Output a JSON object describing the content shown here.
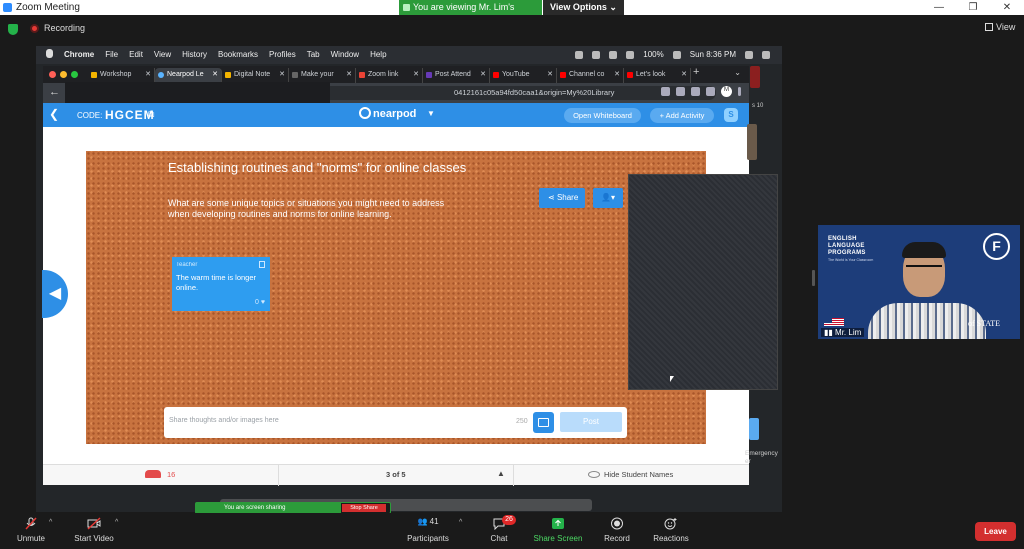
{
  "zoom": {
    "window_title": "Zoom Meeting",
    "viewing_banner": "You are viewing Mr. Lim's screen",
    "view_options": "View Options",
    "recording": "Recording",
    "view_label": "View"
  },
  "mac": {
    "menu": [
      "Chrome",
      "File",
      "Edit",
      "View",
      "History",
      "Bookmarks",
      "Profiles",
      "Tab",
      "Window",
      "Help"
    ],
    "battery": "100%",
    "clock": "Sun 8:36 PM"
  },
  "chrome": {
    "tabs": [
      {
        "label": "Workshop",
        "active": false
      },
      {
        "label": "Nearpod Le",
        "active": true
      },
      {
        "label": "Digital Note",
        "active": false
      },
      {
        "label": "Make your",
        "active": false
      },
      {
        "label": "Zoom link",
        "active": false
      },
      {
        "label": "Post Attend",
        "active": false
      },
      {
        "label": "YouTube",
        "active": false
      },
      {
        "label": "Channel co",
        "active": false
      },
      {
        "label": "Let's look",
        "active": false
      }
    ],
    "url_visible": "0412161c05a94fd50caa1&origin=My%20Library",
    "profile_initial": "M"
  },
  "nearpod": {
    "code_label": "CODE:",
    "code": "HGCEM",
    "logo": "nearpod",
    "open_whiteboard": "Open Whiteboard",
    "add_activity": "+ Add Activity",
    "avatar_letter": "S",
    "board_title": "Establishing routines and \"norms\" for online classes",
    "board_description": "What are some unique topics or situations you might need to address when developing routines and norms for online learning.",
    "share_label": "Share",
    "post": {
      "role": "Teacher",
      "text": "The warm time is longer online.",
      "likes": "0"
    },
    "input_placeholder": "Share thoughts and/or images here",
    "char_count": "250",
    "post_button": "Post",
    "footer": {
      "participants": "16",
      "page": "3 of 5",
      "hide_names": "Hide Student Names"
    }
  },
  "mac_side": {
    "side_label_top": "s 10",
    "side_label_bottom": "Emergency er"
  },
  "screen_share_bar": {
    "status": "You are screen sharing",
    "stop": "Stop Share"
  },
  "video": {
    "org_line1": "ENGLISH",
    "org_line2": "LANGUAGE",
    "org_line3": "PROGRAMS",
    "org_tagline": "The World is Your Classroom",
    "badge": "F",
    "state_text": "of STATE",
    "participant_name": "Mr. Lim"
  },
  "toolbar": {
    "unmute": "Unmute",
    "start_video": "Start Video",
    "participants": "Participants",
    "participants_count": "41",
    "chat": "Chat",
    "chat_badge": "26",
    "share_screen": "Share Screen",
    "record": "Record",
    "reactions": "Reactions",
    "leave": "Leave"
  },
  "colors": {
    "zoom_green": "#2c9b3a",
    "nearpod_blue": "#2e8fe6",
    "cork": "#c8733f",
    "leave_red": "#d32f2f"
  }
}
